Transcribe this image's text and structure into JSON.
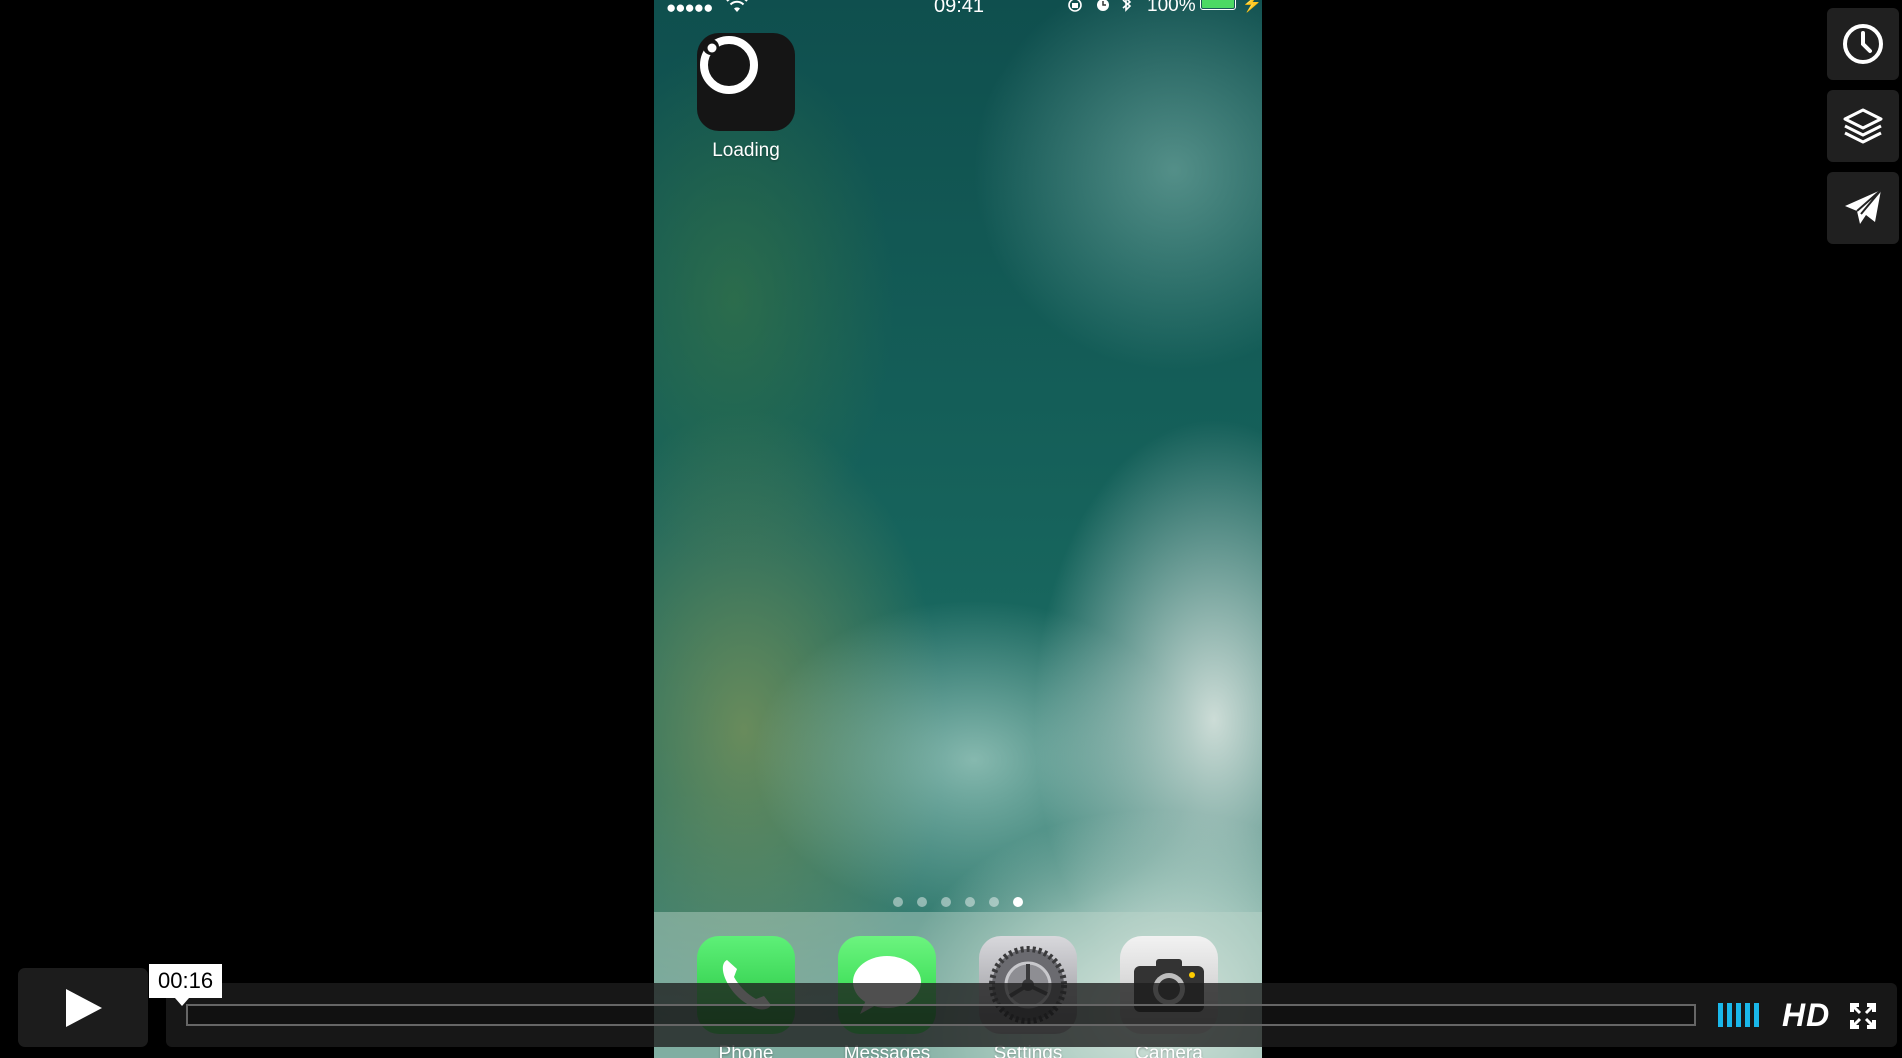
{
  "status_bar": {
    "signal": "●●●●●",
    "time": "09:41",
    "battery_percent": "100%",
    "battery_level": 1.0,
    "battery_color": "#4cd964"
  },
  "home_screen": {
    "apps": [
      {
        "label": "Loading",
        "icon": "loading-app-icon"
      }
    ],
    "page_dots": {
      "count": 6,
      "active_index": 5
    }
  },
  "dock": {
    "apps": [
      {
        "label": "Phone",
        "icon": "phone-icon"
      },
      {
        "label": "Messages",
        "icon": "messages-icon"
      },
      {
        "label": "Settings",
        "icon": "settings-icon"
      },
      {
        "label": "Camera",
        "icon": "camera-icon"
      }
    ]
  },
  "side_buttons": [
    {
      "icon": "clock-icon",
      "name": "watch-later-button"
    },
    {
      "icon": "layers-icon",
      "name": "collections-button"
    },
    {
      "icon": "paper-plane-icon",
      "name": "share-button"
    }
  ],
  "player": {
    "current_time": "00:16",
    "progress": 0.0,
    "quality_label": "HD",
    "accent_color": "#1ab7ea",
    "icons": {
      "play": "play-icon",
      "volume": "volume-bars-icon",
      "fullscreen": "fullscreen-icon"
    }
  }
}
